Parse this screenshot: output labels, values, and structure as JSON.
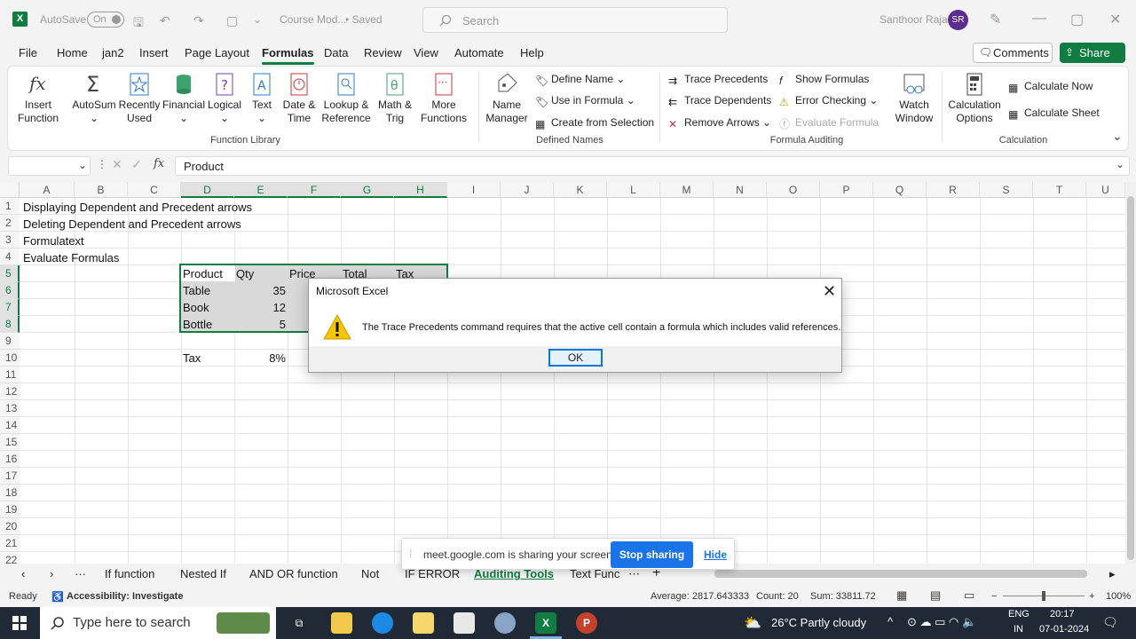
{
  "titlebar": {
    "autosave": "AutoSave",
    "autosave_state": "On",
    "doc_title": "Course Mod...",
    "doc_status": "• Saved",
    "search_placeholder": "Search",
    "user_name": "Santhoor Raja",
    "user_initials": "SR"
  },
  "menu": [
    "File",
    "Home",
    "jan2",
    "Insert",
    "Page Layout",
    "Formulas",
    "Data",
    "Review",
    "View",
    "Automate",
    "Help"
  ],
  "menu_actions": {
    "comments": "Comments",
    "share": "Share"
  },
  "ribbon": {
    "function_library": {
      "label": "Function Library",
      "insert_function": [
        "Insert",
        "Function"
      ],
      "autosum": "AutoSum",
      "recently_used": [
        "Recently",
        "Used"
      ],
      "financial": "Financial",
      "logical": "Logical",
      "text": "Text",
      "date_time": [
        "Date &",
        "Time"
      ],
      "lookup": [
        "Lookup &",
        "Reference"
      ],
      "math": [
        "Math &",
        "Trig"
      ],
      "more": [
        "More",
        "Functions"
      ]
    },
    "defined_names": {
      "label": "Defined Names",
      "name_manager": [
        "Name",
        "Manager"
      ],
      "define_name": "Define Name",
      "use_in_formula": "Use in Formula",
      "create_from_selection": "Create from Selection"
    },
    "formula_auditing": {
      "label": "Formula Auditing",
      "trace_precedents": "Trace Precedents",
      "trace_dependents": "Trace Dependents",
      "remove_arrows": "Remove Arrows",
      "show_formulas": "Show Formulas",
      "error_checking": "Error Checking",
      "evaluate_formula": "Evaluate Formula",
      "watch_window": [
        "Watch",
        "Window"
      ]
    },
    "calculation": {
      "label": "Calculation",
      "calc_options": [
        "Calculation",
        "Options"
      ],
      "calc_now": "Calculate Now",
      "calc_sheet": "Calculate Sheet"
    }
  },
  "formula_bar": {
    "namebox": "",
    "fx": "fx",
    "content": "Product"
  },
  "grid": {
    "columns": [
      "A",
      "B",
      "C",
      "D",
      "E",
      "F",
      "G",
      "H",
      "I",
      "J",
      "K",
      "L",
      "M",
      "N",
      "O",
      "P",
      "Q",
      "R",
      "S",
      "T",
      "U"
    ],
    "rows": [
      "1",
      "2",
      "3",
      "4",
      "5",
      "6",
      "7",
      "8",
      "9",
      "10",
      "11",
      "12",
      "13",
      "14",
      "15",
      "16",
      "17",
      "18",
      "19",
      "20",
      "21",
      "22"
    ],
    "a1": "Displaying Dependent and Precedent arrows",
    "a2": "Deleting Dependent and Precedent arrows",
    "a3": "Formulatext",
    "a4": "Evaluate Formulas",
    "table_headers": [
      "Product",
      "Qty",
      "Price",
      "Total",
      "Tax"
    ],
    "table_rows": [
      {
        "product": "Table",
        "qty": "35"
      },
      {
        "product": "Book",
        "qty": "12"
      },
      {
        "product": "Bottle",
        "qty": "5"
      }
    ],
    "tax_label": "Tax",
    "tax_value": "8%"
  },
  "dialog": {
    "title": "Microsoft Excel",
    "message": "The Trace Precedents command requires that the active cell contain a formula which includes valid references.",
    "ok": "OK"
  },
  "sheets": [
    "If function",
    "Nested If",
    "AND OR function",
    "Not",
    "IF ERROR",
    "Auditing Tools",
    "Text Func"
  ],
  "active_sheet": "Auditing Tools",
  "sharebar": {
    "message": "meet.google.com is sharing your screen.",
    "stop": "Stop sharing",
    "hide": "Hide"
  },
  "status": {
    "ready": "Ready",
    "accessibility": "Accessibility: Investigate",
    "average": "Average: 2817.643333",
    "count": "Count: 20",
    "sum": "Sum: 33811.72",
    "zoom": "100%"
  },
  "taskbar": {
    "search_placeholder": "Type here to search",
    "weather": "26°C  Partly cloudy",
    "lang1": "ENG",
    "lang2": "IN",
    "time": "20:17",
    "date": "07-01-2024"
  },
  "colors": {
    "excel_green": "#107c41",
    "accent_blue": "#0078d7",
    "warning_yellow": "#f7c600"
  }
}
